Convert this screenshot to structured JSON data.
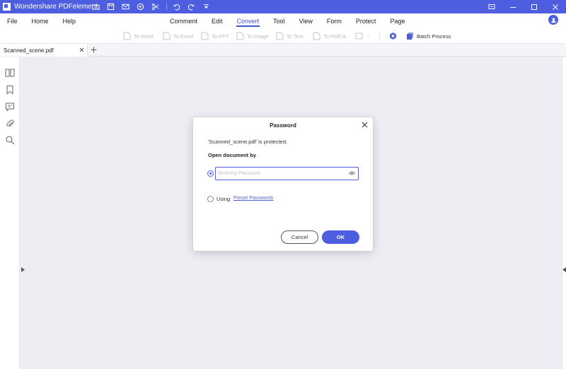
{
  "app": {
    "title": "Wondershare PDFelement",
    "accent": "#4d5fe0",
    "icons": [
      "app-logo-icon",
      "open-folder-icon",
      "save-icon",
      "email-icon",
      "print-icon",
      "scissors-icon",
      "undo-icon",
      "redo-icon",
      "customize-arrow-icon"
    ]
  },
  "menu": {
    "left": [
      "File",
      "Home",
      "Help"
    ],
    "center": [
      "Comment",
      "Edit",
      "Convert",
      "Tool",
      "View",
      "Form",
      "Protect",
      "Page"
    ],
    "active": "Convert"
  },
  "ribbon": {
    "items": [
      "To Word",
      "To Excel",
      "To PPT",
      "To Image",
      "To Text",
      "To PDF/A"
    ],
    "more_label": "",
    "batch_label": "Batch Process"
  },
  "tabs": {
    "document": "Scanned_scene.pdf",
    "add_symbol": "+"
  },
  "dialog": {
    "title": "Password",
    "message": "'Scanned_scene.pdf' is protected.",
    "section": "Open document by",
    "password_placeholder": "Entering Password",
    "password_value": "",
    "using_label": "Using",
    "preset_link": "Preset Passwords",
    "cancel_label": "Cancel",
    "ok_label": "OK"
  }
}
